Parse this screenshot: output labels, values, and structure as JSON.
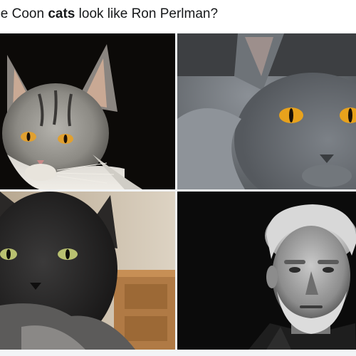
{
  "post": {
    "caption_prefix": "ine Coon ",
    "caption_bold": "cats",
    "caption_suffix": " look like Ron Perlman?"
  },
  "photos": [
    {
      "subject": "silver tabby maine coon cat"
    },
    {
      "subject": "gray maine coon cat with orange eyes"
    },
    {
      "subject": "dark smoke maine coon cat"
    },
    {
      "subject": "black and white portrait of a gray-haired man"
    }
  ],
  "colors": {
    "caption_text": "#16181a",
    "background": "#f2f4f6",
    "cat_eye_amber": "#e0a030",
    "cat_eye_green": "#b8c070"
  }
}
